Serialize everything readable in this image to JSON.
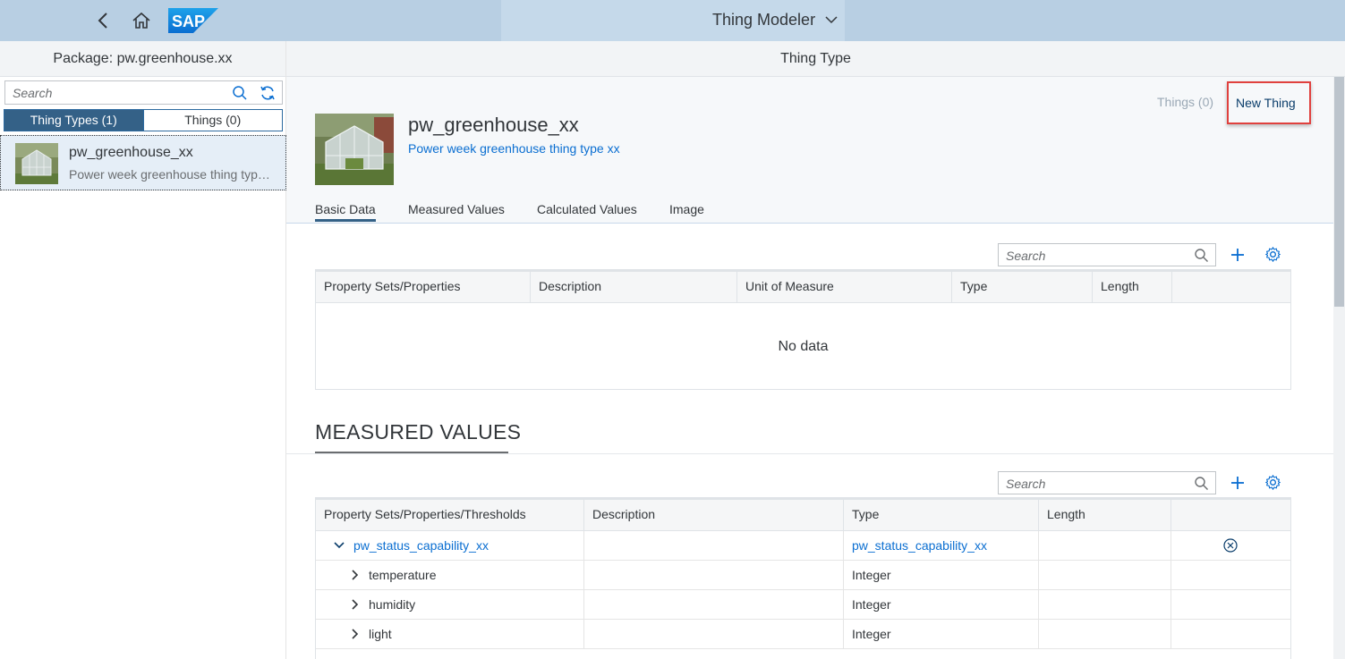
{
  "shell": {
    "title": "Thing Modeler",
    "logo_text": "SAP",
    "icons": {
      "back": "back-icon",
      "home": "home-icon",
      "menu": "chevron-down-icon"
    },
    "colors": {
      "bar": "#b8cfe3",
      "title_area": "#c5d9ea"
    }
  },
  "master": {
    "header": "Package: pw.greenhouse.xx",
    "search_placeholder": "Search",
    "tabs": [
      {
        "label": "Thing Types (1)",
        "active": true
      },
      {
        "label": "Things (0)",
        "active": false
      }
    ],
    "items": [
      {
        "title": "pw_greenhouse_xx",
        "description": "Power week greenhouse thing type xx"
      }
    ]
  },
  "detail": {
    "header": "Thing Type",
    "actions": {
      "things_link": "Things (0)",
      "new_thing": "New Thing"
    },
    "object": {
      "title": "pw_greenhouse_xx",
      "subtitle": "Power week greenhouse thing type xx"
    },
    "tabs": [
      "Basic Data",
      "Measured Values",
      "Calculated Values",
      "Image"
    ],
    "selected_tab": "Basic Data",
    "basic_data": {
      "search_placeholder": "Search",
      "columns": [
        "Property Sets/Properties",
        "Description",
        "Unit of Measure",
        "Type",
        "Length",
        ""
      ],
      "empty_text": "No data"
    },
    "measured_values": {
      "title": "MEASURED VALUES",
      "search_placeholder": "Search",
      "columns": [
        "Property Sets/Properties/Thresholds",
        "Description",
        "Type",
        "Length",
        ""
      ],
      "rows": [
        {
          "name": "pw_status_capability_xx",
          "description": "",
          "type": "pw_status_capability_xx",
          "length": "",
          "expanded": true,
          "level": 0
        },
        {
          "name": "temperature",
          "description": "",
          "type": "Integer",
          "length": "",
          "expanded": false,
          "level": 1
        },
        {
          "name": "humidity",
          "description": "",
          "type": "Integer",
          "length": "",
          "expanded": false,
          "level": 1
        },
        {
          "name": "light",
          "description": "",
          "type": "Integer",
          "length": "",
          "expanded": false,
          "level": 1
        }
      ]
    }
  }
}
